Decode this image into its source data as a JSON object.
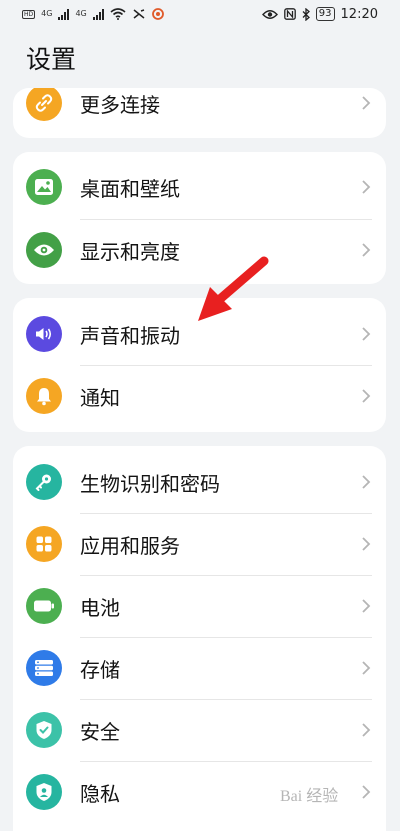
{
  "status_bar": {
    "time": "12:20",
    "battery": "93",
    "network_labels": [
      "4G",
      "4G"
    ],
    "left_icons": [
      "hd-icon",
      "signal-icon",
      "signal-icon",
      "wifi-icon",
      "data-icon",
      "app-notification-icon"
    ],
    "right_icons": [
      "eye-icon",
      "nfc-icon",
      "bluetooth-icon",
      "battery-icon"
    ]
  },
  "page": {
    "title": "设置"
  },
  "groups": [
    {
      "items": [
        {
          "label": "更多连接",
          "icon": "link-icon",
          "color": "#f5a623"
        }
      ]
    },
    {
      "items": [
        {
          "label": "桌面和壁纸",
          "icon": "wallpaper-icon",
          "color": "#4caf50"
        },
        {
          "label": "显示和亮度",
          "icon": "eye-icon",
          "color": "#43a047"
        }
      ]
    },
    {
      "items": [
        {
          "label": "声音和振动",
          "icon": "speaker-icon",
          "color": "#5b4ae0"
        },
        {
          "label": "通知",
          "icon": "bell-icon",
          "color": "#f5a623"
        }
      ]
    },
    {
      "items": [
        {
          "label": "生物识别和密码",
          "icon": "key-icon",
          "color": "#26b5a0"
        },
        {
          "label": "应用和服务",
          "icon": "apps-icon",
          "color": "#f5a623"
        },
        {
          "label": "电池",
          "icon": "battery-icon",
          "color": "#4caf50"
        },
        {
          "label": "存储",
          "icon": "storage-icon",
          "color": "#2f7be8"
        },
        {
          "label": "安全",
          "icon": "shield-icon",
          "color": "#3cc2a8"
        },
        {
          "label": "隐私",
          "icon": "privacy-icon",
          "color": "#26b5a0"
        }
      ]
    }
  ],
  "annotation": {
    "arrow_color": "#e82020"
  },
  "watermark": {
    "text": "Bai 经验"
  }
}
